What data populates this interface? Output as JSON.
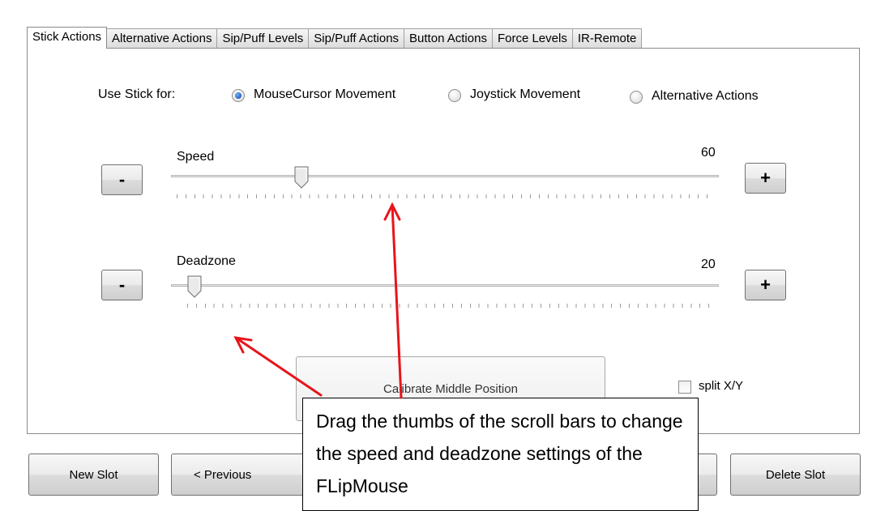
{
  "tabs": [
    "Stick Actions",
    "Alternative Actions",
    "Sip/Puff Levels",
    "Sip/Puff Actions",
    "Button Actions",
    "Force Levels",
    "IR-Remote"
  ],
  "use_stick": {
    "label": "Use Stick for:",
    "options": [
      {
        "label": "MouseCursor Movement",
        "selected": true
      },
      {
        "label": "Joystick Movement",
        "selected": false
      },
      {
        "label": "Alternative Actions",
        "selected": false
      }
    ]
  },
  "speed": {
    "label": "Speed",
    "value": "60",
    "minus": "-",
    "plus": "+"
  },
  "deadzone": {
    "label": "Deadzone",
    "value": "20",
    "minus": "-",
    "plus": "+"
  },
  "calibrate_label": "Calibrate Middle Position",
  "split_xy": {
    "label": "split X/Y",
    "checked": false
  },
  "bottom": {
    "new_slot": "New Slot",
    "previous": "< Previous",
    "delete_slot": "Delete Slot"
  },
  "callout_text": "Drag the thumbs of the scroll bars to change the speed and deadzone settings of the FLipMouse",
  "colors": {
    "annotation_arrow": "#e8141b",
    "radio_selected": "#1f5fc4"
  }
}
